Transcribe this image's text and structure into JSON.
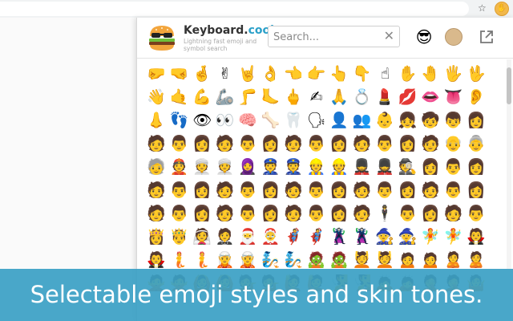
{
  "browser": {
    "star_icon": "star-icon",
    "extension_icon": "extension-icon"
  },
  "header": {
    "brand_name": "Keyboard.",
    "brand_accent": "cool",
    "tagline": "Lightning fast emoji and symbol search",
    "logo_icon": "burger-sunglasses-logo"
  },
  "search": {
    "placeholder": "Search...",
    "value": ""
  },
  "toolbar": {
    "style_button": "😎",
    "skin_tone_color": "#d9b98c",
    "popout_icon": "popout-icon"
  },
  "emojis": [
    "🤛",
    "🤜",
    "🤞",
    "✌",
    "🤘",
    "👌",
    "👈",
    "👉",
    "👆",
    "👇",
    "☝",
    "✋",
    "🤚",
    "🖐",
    "🖖",
    "👋",
    "🤙",
    "💪",
    "🦾",
    "🦵",
    "🦶",
    "🖕",
    "✍",
    "🙏",
    "💍",
    "💄",
    "💋",
    "👄",
    "👅",
    "👂",
    "👃",
    "👣",
    "👁",
    "👀",
    "🧠",
    "🦴",
    "🦷",
    "🗣",
    "👤",
    "👥",
    "👶",
    "👧",
    "🧒",
    "👦",
    "👩",
    "🧑",
    "👨",
    "👩",
    "🧑",
    "👨",
    "👩",
    "🧑",
    "👨",
    "👩",
    "🧑",
    "👨",
    "👩",
    "🧑",
    "👴",
    "👵",
    "🧓",
    "👲",
    "👳",
    "👳",
    "🧕",
    "👮",
    "👮",
    "👷",
    "👷",
    "💂",
    "💂",
    "🕵",
    "👩",
    "👨",
    "👩",
    "🧑",
    "👨",
    "👩",
    "🧑",
    "👨",
    "👩",
    "🧑",
    "👨",
    "👩",
    "🧑",
    "👨",
    "👩",
    "🧑",
    "👨",
    "👩",
    "🧑",
    "👨",
    "👩",
    "🧑",
    "👨",
    "👩",
    "🧑",
    "👨",
    "👩",
    "🧑",
    "🕴",
    "👨",
    "👩",
    "🧑",
    "👨",
    "👸",
    "🤴",
    "👰",
    "🤵",
    "🎅",
    "🤶",
    "🦸",
    "🦸",
    "🦹",
    "🦹",
    "🧙",
    "🧙",
    "🧚",
    "🧚",
    "🧛",
    "🧛",
    "🧜",
    "🧜",
    "🧝",
    "🧝",
    "🧞",
    "🧞",
    "🧟",
    "🧟",
    "💆",
    "💆",
    "🙍",
    "🙍",
    "🙎",
    "🙎",
    "🙅",
    "🙅",
    "🙆",
    "🙆",
    "💁",
    "💁",
    "🙋",
    "🙋",
    "🧏",
    "🧏",
    "🙇",
    "🙇",
    "🤦",
    "🤦",
    "🤷"
  ],
  "caption": "Selectable emoji styles and skin tones."
}
